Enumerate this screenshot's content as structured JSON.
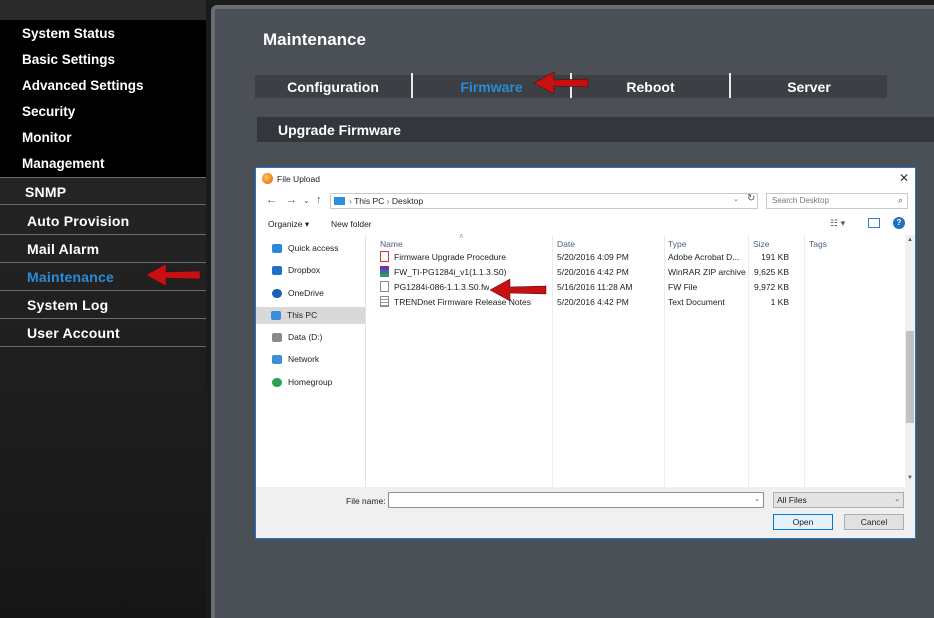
{
  "sidebar": {
    "main_items": [
      "System Status",
      "Basic Settings",
      "Advanced Settings",
      "Security",
      "Monitor",
      "Management"
    ],
    "sub_items": [
      {
        "label": "SNMP",
        "active": false
      },
      {
        "label": "Auto Provision",
        "active": false
      },
      {
        "label": "Mail Alarm",
        "active": false
      },
      {
        "label": "Maintenance",
        "active": true
      },
      {
        "label": "System Log",
        "active": false
      },
      {
        "label": "User Account",
        "active": false
      }
    ]
  },
  "page": {
    "title": "Maintenance",
    "tabs": [
      {
        "label": "Configuration",
        "active": false
      },
      {
        "label": "Firmware",
        "active": true
      },
      {
        "label": "Reboot",
        "active": false
      },
      {
        "label": "Server",
        "active": false
      }
    ],
    "section_title": "Upgrade Firmware"
  },
  "dialog": {
    "title": "File Upload",
    "address": {
      "parts": [
        "This PC",
        "Desktop"
      ]
    },
    "search_placeholder": "Search Desktop",
    "toolbar": {
      "organize": "Organize ▾",
      "new_folder": "New folder"
    },
    "nav_items": [
      {
        "label": "Quick access",
        "icon": "star-icon",
        "color": "#2b88d8",
        "selected": false
      },
      {
        "label": "Dropbox",
        "icon": "dropbox-icon",
        "color": "#1e6fc9",
        "selected": false
      },
      {
        "label": "OneDrive",
        "icon": "cloud-icon",
        "color": "#1a5fb4",
        "selected": false
      },
      {
        "label": "This PC",
        "icon": "computer-icon",
        "color": "#3a8fd6",
        "selected": true
      },
      {
        "label": "Data (D:)",
        "icon": "drive-icon",
        "color": "#8a8a8a",
        "selected": false
      },
      {
        "label": "Network",
        "icon": "network-icon",
        "color": "#3a8fd6",
        "selected": false
      },
      {
        "label": "Homegroup",
        "icon": "homegroup-icon",
        "color": "#2aa14a",
        "selected": false
      }
    ],
    "columns": {
      "name": "Name",
      "date": "Date",
      "type": "Type",
      "size": "Size",
      "tags": "Tags"
    },
    "files": [
      {
        "name": "Firmware Upgrade Procedure",
        "date": "5/20/2016 4:09 PM",
        "type": "Adobe Acrobat D...",
        "size": "191 KB",
        "icon": "pdf-icon",
        "color": "#d03a2c"
      },
      {
        "name": "FW_TI-PG1284i_v1(1.1.3.S0)",
        "date": "5/20/2016 4:42 PM",
        "type": "WinRAR ZIP archive",
        "size": "9,625 KB",
        "icon": "archive-icon",
        "color": "#8b2b8f"
      },
      {
        "name": "PG1284i-086-1.1.3.S0.fw",
        "date": "5/16/2016 11:28 AM",
        "type": "FW File",
        "size": "9,972 KB",
        "icon": "file-icon",
        "color": "#ffffff"
      },
      {
        "name": "TRENDnet Firmware Release Notes",
        "date": "5/20/2016 4:42 PM",
        "type": "Text Document",
        "size": "1 KB",
        "icon": "text-file-icon",
        "color": "#ffffff"
      }
    ],
    "file_name_label": "File name:",
    "file_name_value": "",
    "filter": "All Files",
    "open_label": "Open",
    "cancel_label": "Cancel"
  },
  "colors": {
    "active_blue": "#2a8bd8",
    "arrow_red": "#c80f12"
  }
}
